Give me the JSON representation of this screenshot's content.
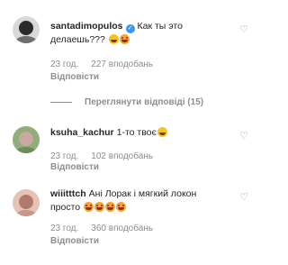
{
  "comments": [
    {
      "username": "santadimopulos",
      "verified": true,
      "text": "Как ты это делаешь???",
      "emojis": [
        "laughing-emoji",
        "heart-eyes-emoji"
      ],
      "time": "23 год.",
      "likes": "227 вподобань",
      "reply_label": "Відповісти",
      "view_replies_label": "Переглянути відповіді (15)",
      "avatar_colors": [
        "#2b2b2b",
        "#6e6e6e"
      ]
    },
    {
      "username": "ksuha_kachur",
      "verified": false,
      "text": "1-то твоє",
      "emojis": [
        "laughing-emoji"
      ],
      "time": "23 год.",
      "likes": "102 вподобань",
      "reply_label": "Відповісти",
      "avatar_colors": [
        "#8fae7a",
        "#c9a9a0"
      ]
    },
    {
      "username": "wiiitttch",
      "verified": false,
      "text": "Ані Лорак і мягкий локон просто",
      "emojis": [
        "heart-eyes-emoji",
        "heart-eyes-emoji",
        "heart-eyes-emoji",
        "heart-eyes-emoji"
      ],
      "time": "23 год.",
      "likes": "360 вподобань",
      "reply_label": "Відповісти",
      "avatar_colors": [
        "#b07a6c",
        "#e6c3b5"
      ]
    }
  ],
  "like_icon": "heart-outline-icon"
}
